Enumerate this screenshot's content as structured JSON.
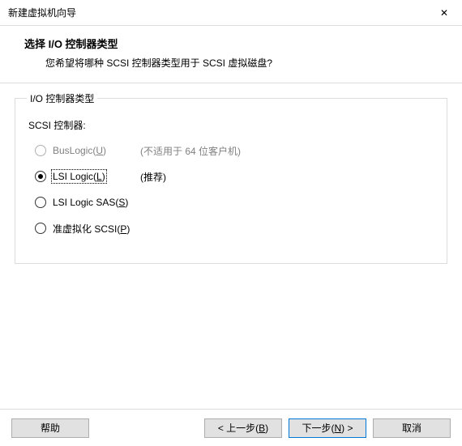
{
  "titlebar": {
    "title": "新建虚拟机向导",
    "close_glyph": "✕"
  },
  "header": {
    "heading": "选择 I/O 控制器类型",
    "subheading": "您希望将哪种 SCSI 控制器类型用于 SCSI 虚拟磁盘?"
  },
  "group": {
    "legend": "I/O 控制器类型",
    "scsi_label": "SCSI 控制器:",
    "options": {
      "buslogic": {
        "label_pre": "BusLogic(",
        "accel": "U",
        "label_post": ")",
        "note": "(不适用于 64 位客户机)"
      },
      "lsilogic": {
        "label_pre": "LSI Logic(",
        "accel": "L",
        "label_post": ")",
        "note": "(推荐)"
      },
      "lsilogicsas": {
        "label_pre": "LSI Logic SAS(",
        "accel": "S",
        "label_post": ")"
      },
      "pvscsi": {
        "label_pre": "准虚拟化 SCSI(",
        "accel": "P",
        "label_post": ")"
      }
    }
  },
  "footer": {
    "help": "帮助",
    "back_pre": "< 上一步(",
    "back_accel": "B",
    "back_post": ")",
    "next_pre": "下一步(",
    "next_accel": "N",
    "next_post": ") >",
    "cancel": "取消"
  }
}
